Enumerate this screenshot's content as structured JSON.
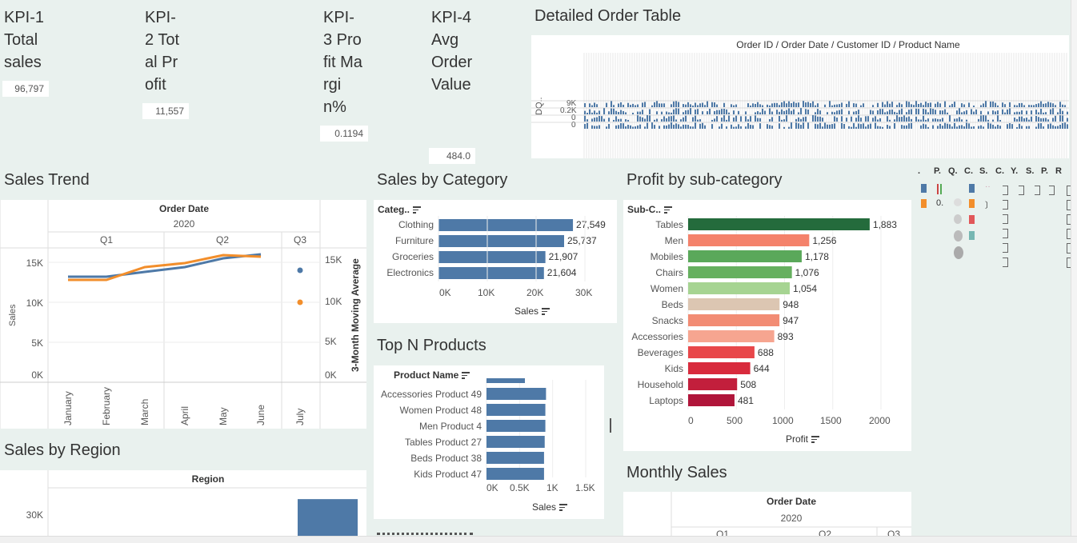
{
  "kpis": [
    {
      "title": "KPI-1 Total sales",
      "value": "96,797"
    },
    {
      "title": "KPI-2 Total Profit",
      "value": "11,557"
    },
    {
      "title": "KPI-3 Profit Margin%",
      "value": "0.1194"
    },
    {
      "title": "KPI-4 Avg Order Value",
      "value": "484.0"
    }
  ],
  "order_table": {
    "title": "Detailed Order Table",
    "header": "Order ID / Order Date / Customer ID / Product Name",
    "row_label": "DQ..",
    "ticks": [
      "9K",
      "0.2K",
      "0",
      "0"
    ]
  },
  "sales_trend": {
    "title": "Sales Trend",
    "header": "Order Date",
    "year": "2020",
    "quarters": [
      "Q1",
      "Q2",
      "Q3"
    ],
    "months": [
      "January",
      "February",
      "March",
      "April",
      "May",
      "June",
      "July"
    ],
    "ylabel": "Sales",
    "ylabel_right": "3-Month Moving Average",
    "yticks": [
      "15K",
      "10K",
      "5K",
      "0K"
    ],
    "yticks_right": [
      "15K",
      "10K",
      "5K",
      "0K"
    ]
  },
  "sales_by_category": {
    "title": "Sales by Category",
    "header": "Categ..",
    "xlabel": "Sales",
    "xticks": [
      "0K",
      "10K",
      "20K",
      "30K"
    ]
  },
  "profit_by_subcategory": {
    "title": "Profit by sub-category",
    "header": "Sub-C..",
    "xlabel": "Profit",
    "xticks": [
      "0",
      "500",
      "1000",
      "1500",
      "2000"
    ]
  },
  "top_n_products": {
    "title": "Top N Products",
    "header": "Product Name",
    "xlabel": "Sales",
    "xticks": [
      "0K",
      "0.5K",
      "1K",
      "1.5K"
    ]
  },
  "sales_by_region": {
    "title": "Sales by Region",
    "header": "Region",
    "yticks": [
      "30K"
    ]
  },
  "monthly_sales": {
    "title": "Monthly Sales",
    "header": "Order Date",
    "year": "2020",
    "quarters": [
      "Q1",
      "Q2",
      "Q3"
    ]
  },
  "legend_panel": {
    "headers": [
      ".",
      "P.",
      "Q.",
      "C.",
      "S.",
      "C.",
      "Y.",
      "S.",
      "P.",
      "R"
    ],
    "sample_text": "0."
  },
  "colors": {
    "background": "#e9f1ee",
    "bar_blue": "#4e79a7",
    "line_orange": "#f28e2b",
    "tables": "#246b3c",
    "men": "#f4826b",
    "mobiles": "#5aa85a",
    "chairs": "#66b05f",
    "women": "#a6d492",
    "beds": "#dcc6b2",
    "snacks": "#f28c74",
    "accessories": "#f6a590",
    "beverages": "#e8474a",
    "kids": "#d82b3d",
    "household": "#c21f3c",
    "laptops": "#b0153a"
  },
  "chart_data": [
    {
      "type": "line",
      "title": "Sales Trend",
      "xlabel": "Order Date",
      "ylabel": "Sales",
      "x": [
        "January",
        "February",
        "March",
        "April",
        "May",
        "June",
        "July"
      ],
      "series": [
        {
          "name": "Sales",
          "values": [
            13200,
            13200,
            13800,
            14400,
            15500,
            16000,
            14000
          ]
        },
        {
          "name": "3-Month Moving Average",
          "values": [
            12800,
            12800,
            14400,
            14900,
            15900,
            15700,
            10000
          ]
        }
      ],
      "ylim": [
        0,
        17000
      ]
    },
    {
      "type": "bar",
      "title": "Sales by Category",
      "categories": [
        "Clothing",
        "Furniture",
        "Groceries",
        "Electronics"
      ],
      "values": [
        27549,
        25737,
        21907,
        21604
      ],
      "xlabel": "Sales",
      "xlim": [
        0,
        35000
      ]
    },
    {
      "type": "bar",
      "title": "Profit by sub-category",
      "categories": [
        "Tables",
        "Men",
        "Mobiles",
        "Chairs",
        "Women",
        "Beds",
        "Snacks",
        "Accessories",
        "Beverages",
        "Kids",
        "Household",
        "Laptops"
      ],
      "values": [
        1883,
        1256,
        1178,
        1076,
        1054,
        948,
        947,
        893,
        688,
        644,
        508,
        481
      ],
      "xlabel": "Profit",
      "xlim": [
        0,
        2300
      ]
    },
    {
      "type": "bar",
      "title": "Top N Products",
      "categories": [
        "Accessories Product 49",
        "Women Product 48",
        "Men Product 4",
        "Tables Product 27",
        "Beds Product 38",
        "Kids Product 47"
      ],
      "values": [
        900,
        890,
        890,
        880,
        870,
        870
      ],
      "xlabel": "Sales",
      "xlim": [
        0,
        1800
      ]
    },
    {
      "type": "bar",
      "title": "Sales by Region",
      "categories": [
        ""
      ],
      "values": [
        32000
      ],
      "ylim": [
        0,
        34000
      ]
    }
  ]
}
